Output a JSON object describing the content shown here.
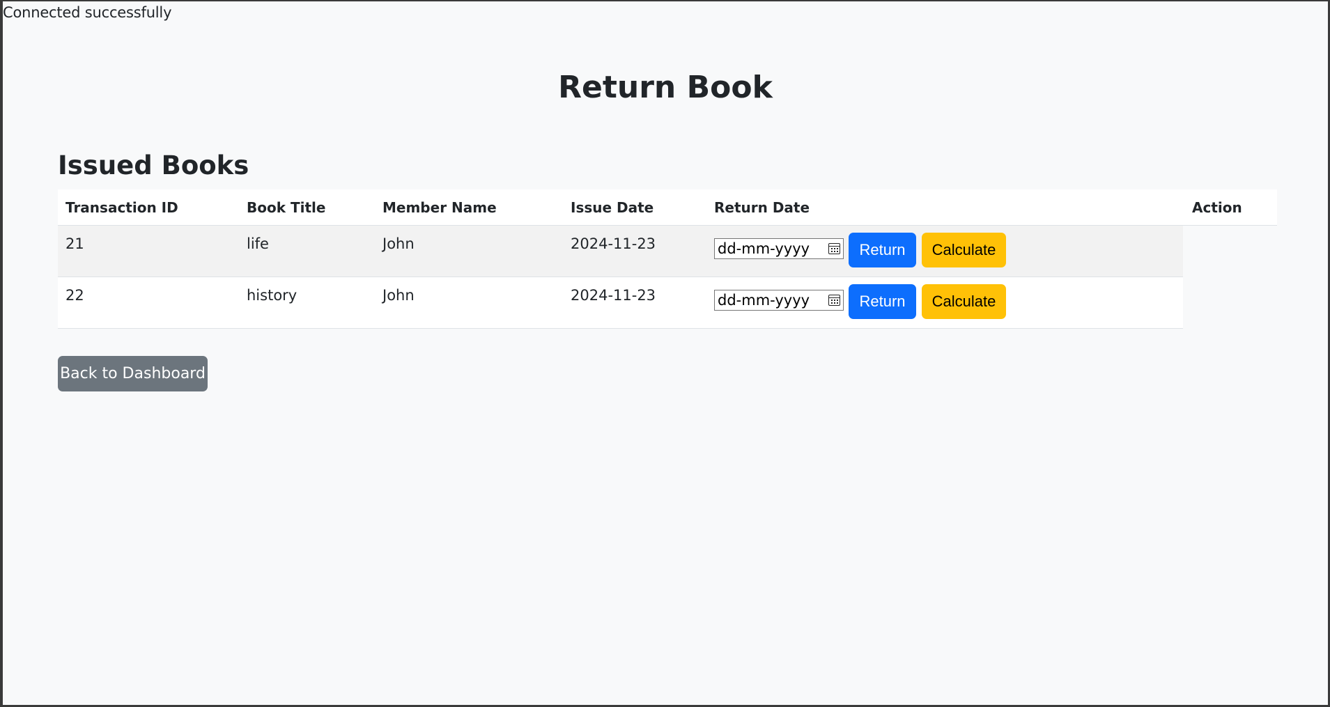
{
  "status_message": "Connected successfully",
  "page_title": "Return Book",
  "section_title": "Issued Books",
  "table": {
    "headers": {
      "transaction_id": "Transaction ID",
      "book_title": "Book Title",
      "member_name": "Member Name",
      "issue_date": "Issue Date",
      "return_date": "Return Date",
      "action": "Action"
    },
    "rows": [
      {
        "transaction_id": "21",
        "book_title": "life",
        "member_name": "John",
        "issue_date": "2024-11-23",
        "return_date_placeholder": "dd-mm-yyyy",
        "return_label": "Return",
        "calculate_label": "Calculate"
      },
      {
        "transaction_id": "22",
        "book_title": "history",
        "member_name": "John",
        "issue_date": "2024-11-23",
        "return_date_placeholder": "dd-mm-yyyy",
        "return_label": "Return",
        "calculate_label": "Calculate"
      }
    ]
  },
  "back_button_label": "Back to Dashboard",
  "colors": {
    "primary": "#0d6efd",
    "warning": "#ffc107",
    "secondary": "#6c757d",
    "background": "#f8f9fa"
  },
  "icons": {
    "date_picker": "calendar-icon"
  }
}
